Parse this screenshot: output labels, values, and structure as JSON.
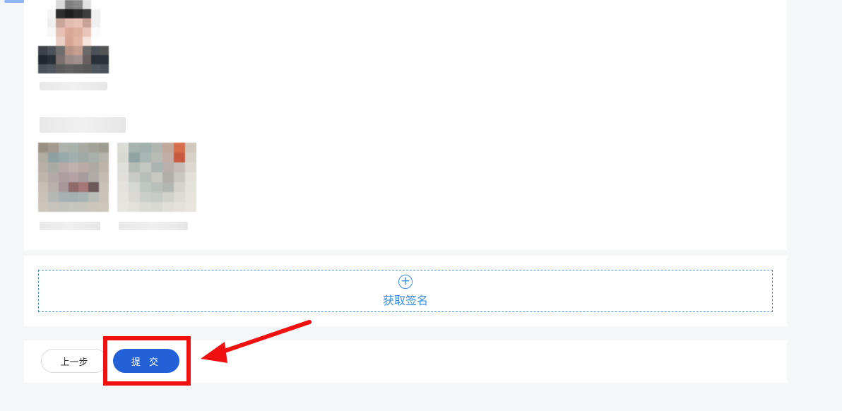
{
  "sign": {
    "label": "获取签名",
    "icon": "plus-circle-icon"
  },
  "actions": {
    "prev_label": "上一步",
    "submit_label": "提 交"
  },
  "colors": {
    "accent": "#2361d8",
    "link": "#3a8ee6",
    "highlight": "#f01010"
  }
}
